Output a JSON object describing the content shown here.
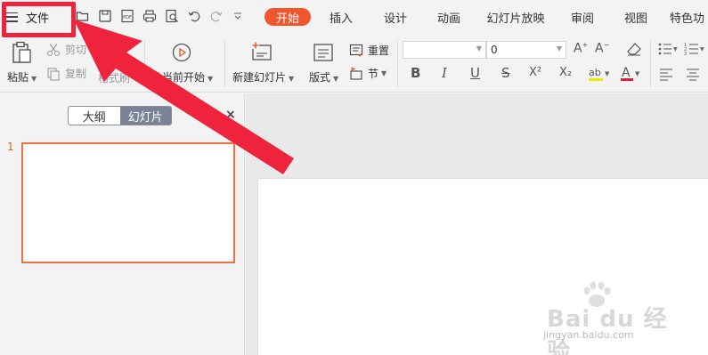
{
  "menubar": {
    "file_label": "文件",
    "tabs": [
      {
        "label": "开始",
        "active": true
      },
      {
        "label": "插入"
      },
      {
        "label": "设计"
      },
      {
        "label": "动画"
      },
      {
        "label": "幻灯片放映"
      },
      {
        "label": "审阅"
      },
      {
        "label": "视图"
      },
      {
        "label": "特色功"
      }
    ]
  },
  "ribbon": {
    "paste": "粘贴",
    "cut": "剪切",
    "copy": "复制",
    "format_painter": "格式刷",
    "from_current": "从当前开始",
    "new_slide": "新建幻灯片",
    "layout": "版式",
    "reset": "重置",
    "section": "节",
    "font_size": "0",
    "font_name": "",
    "bold": "B",
    "italic": "I",
    "underline": "U",
    "strike": "S",
    "superscript": "X²",
    "subscript": "X₂"
  },
  "panel": {
    "outline_tab": "大纲",
    "slides_tab": "幻灯片",
    "close": "×",
    "slide_number": "1"
  },
  "watermark": {
    "brand": "Bai du 经验",
    "url": "jingyan.baidu.com"
  },
  "colors": {
    "accent": "#f0552e",
    "annotation": "#f0233c"
  }
}
